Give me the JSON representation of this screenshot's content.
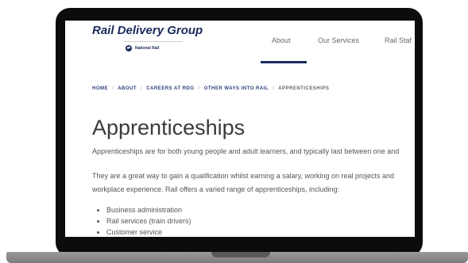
{
  "header": {
    "brand_name": "Rail Delivery Group",
    "sub_brand": "National Rail"
  },
  "nav": {
    "items": [
      {
        "label": "About",
        "active": true
      },
      {
        "label": "Our Services",
        "active": false
      },
      {
        "label": "Rail Staf",
        "active": false
      }
    ]
  },
  "breadcrumb": [
    "HOME",
    "ABOUT",
    "CAREERS AT RDG",
    "OTHER WAYS INTO RAIL",
    "APPRENTICESHIPS"
  ],
  "breadcrumb_separator": "/",
  "page": {
    "title": "Apprenticeships",
    "intro": "Apprenticeships are for both young people and adult learners, and typically last between one and",
    "body_line1": "They are a great way to gain a qualification whilst earning a salary, working on real projects and",
    "body_line2": "workplace experience. Rail offers a varied range of apprenticeships, including:",
    "bullets": [
      "Business administration",
      "Rail services (train drivers)",
      "Customer service"
    ]
  },
  "colors": {
    "brand_navy": "#1b2a5b",
    "laptop_bezel": "#0c0c0d",
    "laptop_base": "#8a8a8a"
  }
}
